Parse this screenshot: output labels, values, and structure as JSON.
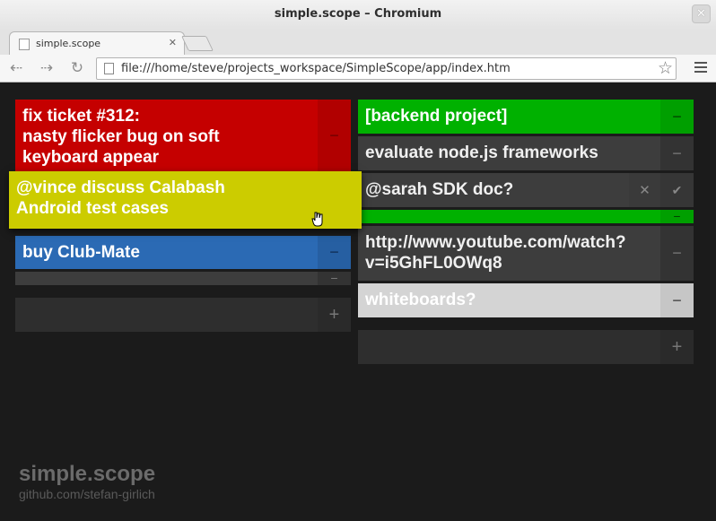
{
  "window": {
    "title": "simple.scope – Chromium",
    "close_glyph": "✕"
  },
  "tab": {
    "label": "simple.scope",
    "close_glyph": "✕",
    "icon": "page-icon"
  },
  "toolbar": {
    "back_glyph": "⇠",
    "forward_glyph": "⇢",
    "reload_glyph": "↻",
    "url": "file:///home/steve/projects_workspace/SimpleScope/app/index.htm",
    "star_glyph": "☆"
  },
  "colors": {
    "red": "#c50000",
    "blue": "#2b6ab4",
    "green": "#00b100",
    "yellow": "#cccc00",
    "gray": "#3d3d3d",
    "light": "#d4d4d4",
    "background": "#1b1b1b"
  },
  "left_column": {
    "card1": {
      "text_line1": "fix ticket #312:",
      "text_line2": "nasty flicker bug on soft",
      "text_line3": "keyboard appear",
      "button": "−"
    },
    "card2": {
      "text": "buy Club-Mate",
      "button": "−"
    },
    "card3": {
      "button": "−"
    },
    "add": {
      "button": "+"
    }
  },
  "dragged": {
    "text_line1": "@vince discuss Calabash",
    "text_line2": "Android test cases"
  },
  "right_column": {
    "card1": {
      "text": "[backend project]",
      "button": "−"
    },
    "card2": {
      "text": "evaluate node.js frameworks",
      "button": "−"
    },
    "card3": {
      "text": "@sarah SDK doc?",
      "cancel": "✕",
      "confirm": "✔"
    },
    "card4": {
      "button": "−"
    },
    "card5": {
      "text_line1": "http://www.youtube.com/watch?",
      "text_line2": "v=i5GhFL0OWq8",
      "button": "−"
    },
    "card6": {
      "text": "whiteboards?",
      "button": "−"
    },
    "add": {
      "button": "+"
    }
  },
  "footer": {
    "title": "simple.scope",
    "link": "github.com/stefan-girlich"
  }
}
